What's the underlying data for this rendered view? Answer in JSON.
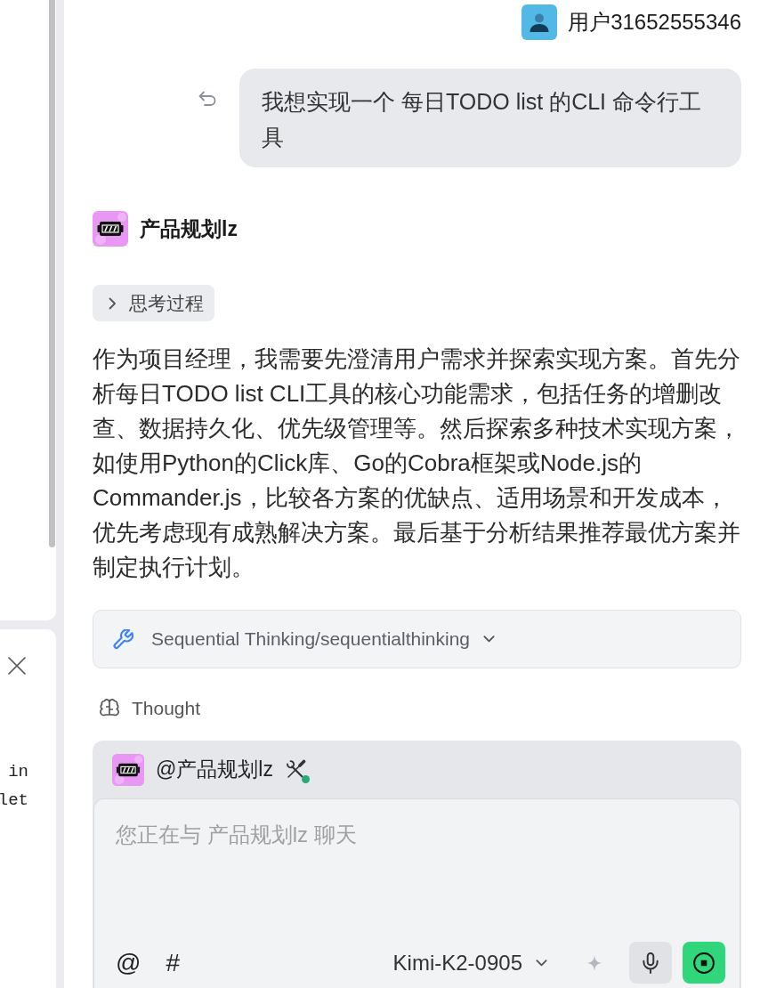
{
  "side_panel": {
    "code_lines": [
      "in",
      "let"
    ]
  },
  "messages": [
    {
      "kind": "user",
      "author": "用户31652555346",
      "text": "我想实现一个 每日TODO list 的CLI 命令行工具"
    },
    {
      "kind": "agent",
      "author": "产品规划lz",
      "thinking": {
        "label": "思考过程",
        "expanded": false
      },
      "text": "作为项目经理，我需要先澄清用户需求并探索实现方案。首先分析每日TODO list CLI工具的核心功能需求，包括任务的增删改查、数据持久化、优先级管理等。然后探索多种技术实现方案，如使用Python的Click库、Go的Cobra框架或Node.js的Commander.js，比较各方案的优缺点、适用场景和开发成本，优先考虑现有成熟解决方案。最后基于分析结果推荐最优方案并制定执行计划。",
      "tool_call": {
        "label": "Sequential Thinking/sequentialthinking",
        "expanded": false
      },
      "step": "Thought"
    }
  ],
  "composer": {
    "agent": "@产品规划lz",
    "tools_active": true,
    "placeholder": "您正在与 产品规划lz 聊天",
    "toolbar": [
      "@",
      "#"
    ],
    "model": "Kimi-K2-0905",
    "generating": true
  }
}
